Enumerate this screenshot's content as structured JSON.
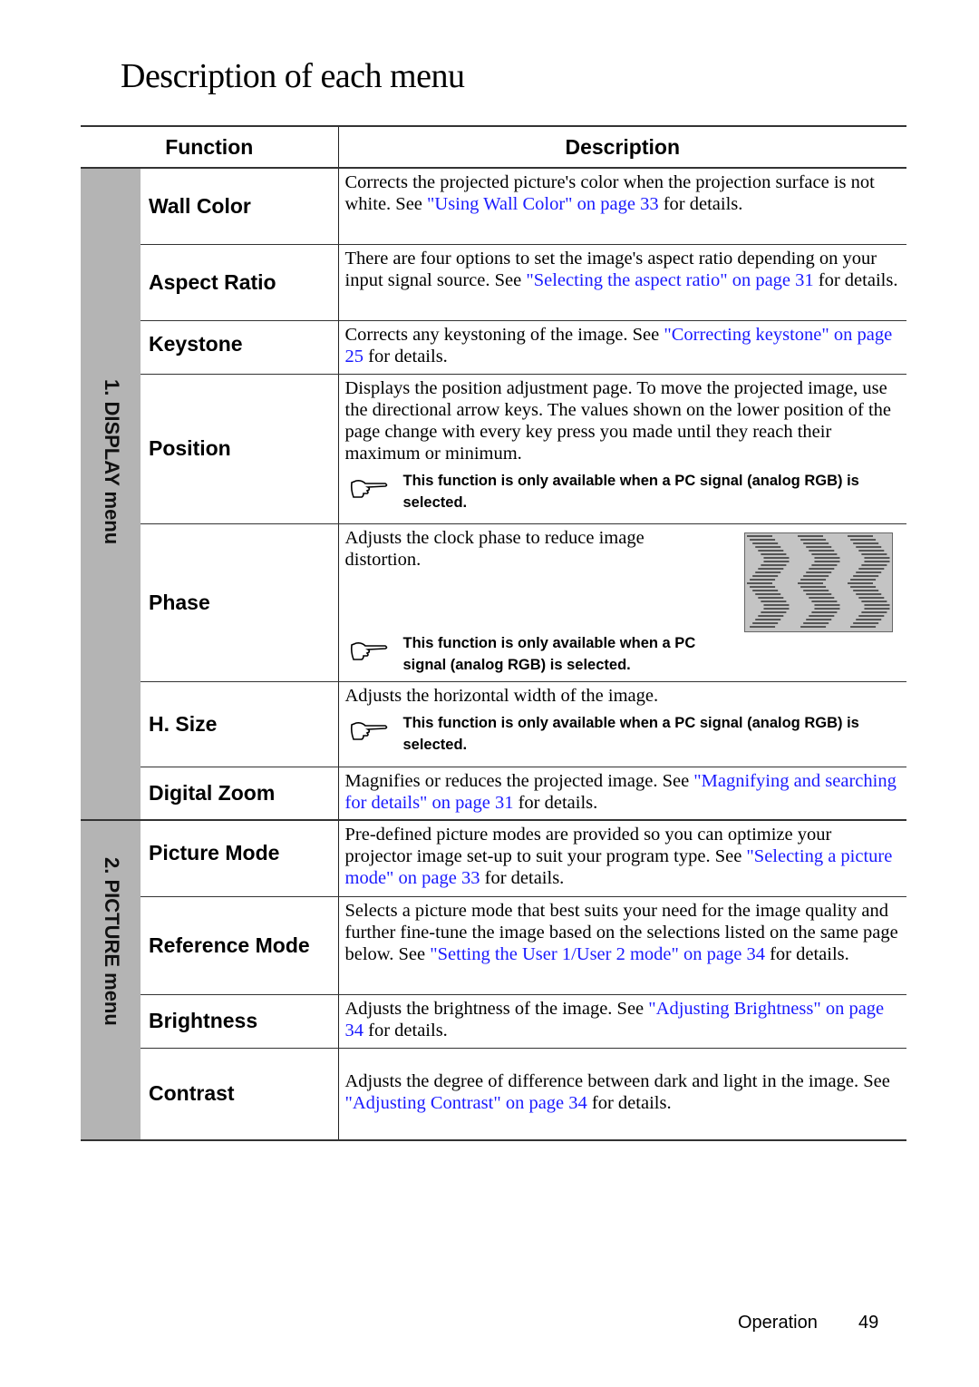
{
  "page": {
    "title": "Description of each menu",
    "footer": {
      "section": "Operation",
      "page_number": "49"
    }
  },
  "table": {
    "headers": {
      "function": "Function",
      "description": "Description"
    },
    "note_text_long": "This function is only available when a PC signal (analog RGB) is selected.",
    "groups": [
      {
        "label": "1. DISPLAY menu",
        "rows": [
          {
            "function": "Wall Color",
            "desc_before": "Corrects the projected picture's color when the projection surface is not white. See ",
            "link": "\"Using Wall Color\" on page 33",
            "desc_after": " for details."
          },
          {
            "function": "Aspect Ratio",
            "desc_before": "There are four options to set the image's aspect ratio depending on your input signal source. See ",
            "link": "\"Selecting the aspect ratio\" on page 31",
            "desc_after": " for details."
          },
          {
            "function": "Keystone",
            "desc_before": "Corrects any keystoning of the image. See ",
            "link": "\"Correcting keystone\" on page 25",
            "desc_after": " for details."
          },
          {
            "function": "Position",
            "desc_before": "Displays the position adjustment page. To move the projected image, use the directional arrow keys. The values shown on the lower position of the page change with every key press you made until they reach their maximum or minimum.",
            "note": "This function is only available when a PC signal (analog RGB) is selected."
          },
          {
            "function": "Phase",
            "desc_before": "Adjusts the clock phase to reduce image distortion.",
            "note": "This function is only available when a PC signal (analog RGB) is selected.",
            "image": "phase-distortion-illustration"
          },
          {
            "function": "H. Size",
            "desc_before": "Adjusts the horizontal width of the image.",
            "note": "This function is only available when a PC signal (analog RGB) is selected."
          },
          {
            "function": "Digital Zoom",
            "desc_before": "Magnifies or reduces the projected image. See ",
            "link": "\"Magnifying and searching for details\" on page 31",
            "desc_after": " for details."
          }
        ]
      },
      {
        "label": "2. PICTURE menu",
        "rows": [
          {
            "function": "Picture Mode",
            "desc_before": "Pre-defined picture modes are provided so you can optimize your projector image set-up to suit your program type. See ",
            "link": "\"Selecting a picture mode\" on page 33",
            "desc_after": " for details."
          },
          {
            "function": "Reference Mode",
            "desc_before": "Selects a picture mode that best suits your need for the image quality and further fine-tune the image based on the selections listed on the same page below. See ",
            "link": "\"Setting the User 1/User 2 mode\" on page 34",
            "desc_after": " for details."
          },
          {
            "function": "Brightness",
            "desc_before": "Adjusts the brightness of the image. See ",
            "link": "\"Adjusting Brightness\" on page 34",
            "desc_after": " for details."
          },
          {
            "function": "Contrast",
            "desc_before": "Adjusts the degree of difference between dark and light in the image. See ",
            "link": "\"Adjusting Contrast\" on page 34",
            "desc_after": " for details."
          }
        ]
      }
    ]
  },
  "colors": {
    "link": "#1a1aff",
    "sidebar": "#b4b4b4"
  }
}
